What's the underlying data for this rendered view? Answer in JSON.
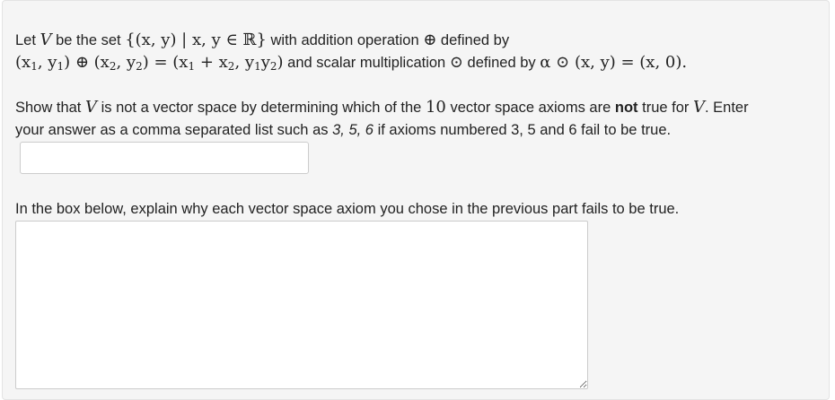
{
  "q1": {
    "let": "Let",
    "V": "V",
    "be_the_set": "be the set",
    "set_expr": "{(x, y) | x, y ∈ ℝ}",
    "with_addition": "with addition operation",
    "oplus": "⊕",
    "defined_by": "defined by",
    "add_lhs_open": "(x",
    "sub1": "1",
    "comma_y": ", y",
    "add_lhs_mid": ") ⊕ (x",
    "sub2": "2",
    "add_rhs": ") = (x",
    "plus_x": " + x",
    "comma_y2": ", y",
    "y2": "y",
    "close": ")",
    "and_scalar": "and scalar multiplication",
    "odot": "⊙",
    "defined_by_2": "defined by",
    "scalar_expr": "α ⊙ (x, y) = (x, 0)."
  },
  "q2": {
    "show_that": "Show that",
    "V": "V",
    "is_not": "is not a vector space by determining which of the",
    "ten": "10",
    "axioms_are": "vector space axioms are",
    "not": "not",
    "true_for": "true for",
    "V2": "V",
    "enter": ". Enter",
    "line2a": "your answer as a comma separated list such as",
    "example": "3, 5, 6",
    "line2b": "if axioms numbered 3, 5 and 6 fail to be true.",
    "input_value": ""
  },
  "q3": {
    "prompt": "In the box below, explain why each vector space axiom you chose in the previous part fails to be true.",
    "textarea_value": ""
  }
}
